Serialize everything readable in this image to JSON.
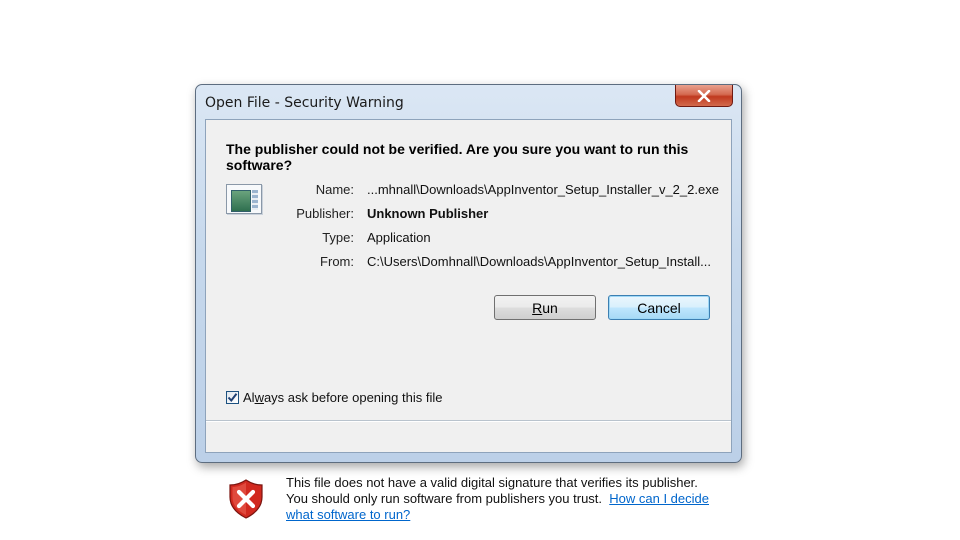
{
  "window": {
    "title": "Open File - Security Warning",
    "close_glyph": "✕"
  },
  "headline": "The publisher could not be verified.  Are you sure you want to run this software?",
  "file_icon": "application-window-icon",
  "properties": [
    {
      "label": "Name:",
      "value": "...mhnall\\Downloads\\AppInventor_Setup_Installer_v_2_2.exe",
      "bold": false
    },
    {
      "label": "Publisher:",
      "value": "Unknown Publisher",
      "bold": true
    },
    {
      "label": "Type:",
      "value": "Application",
      "bold": false
    },
    {
      "label": "From:",
      "value": "C:\\Users\\Domhnall\\Downloads\\AppInventor_Setup_Install...",
      "bold": false
    }
  ],
  "buttons": {
    "run": {
      "mnemonic": "R",
      "rest": "un"
    },
    "cancel": "Cancel"
  },
  "checkbox": {
    "checked": true,
    "label_before": "Al",
    "label_mnemonic": "w",
    "label_after": "ays ask before opening this file"
  },
  "warning": {
    "icon": "security-shield-error-icon",
    "text": "This file does not have a valid digital signature that verifies its publisher. You should only run software from publishers you trust.",
    "link": "How can I decide what software to run?"
  },
  "colors": {
    "link": "#0066cc",
    "close_button": "#c0391f",
    "shield_red": "#d1291f"
  }
}
